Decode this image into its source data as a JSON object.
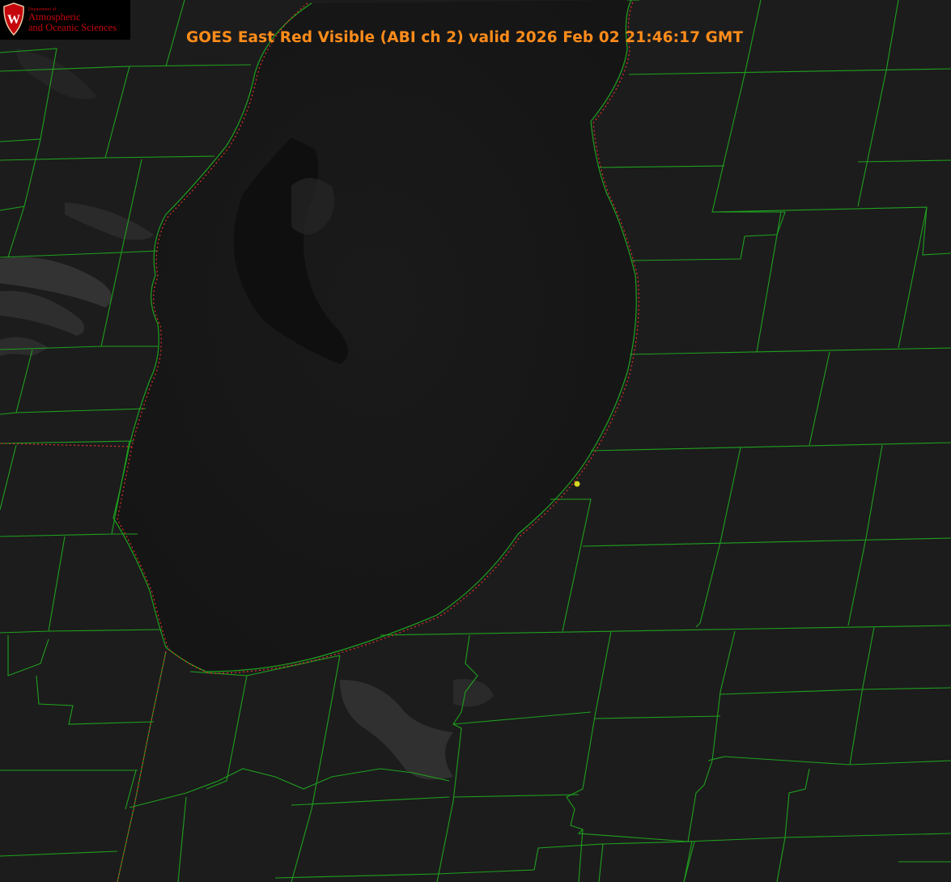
{
  "title": "GOES East Red Visible (ABI ch 2) valid 2026 Feb 02 21:46:17 GMT",
  "logo": {
    "department": "Department of",
    "line1": "Atmospheric",
    "line2": "and Oceanic Sciences",
    "shield_letter": "W"
  },
  "colors": {
    "background": "#1b1b1b",
    "lake": "#161616",
    "title": "#ff8c1a",
    "county_lines": "#1fa01f",
    "state_lines": "#e0302a",
    "station_marker": "#d8d820",
    "logo_red": "#c5050c"
  },
  "map_layers": [
    "satellite-visible-imagery",
    "county-boundaries",
    "state-boundaries",
    "lake-shoreline",
    "station-marker"
  ]
}
